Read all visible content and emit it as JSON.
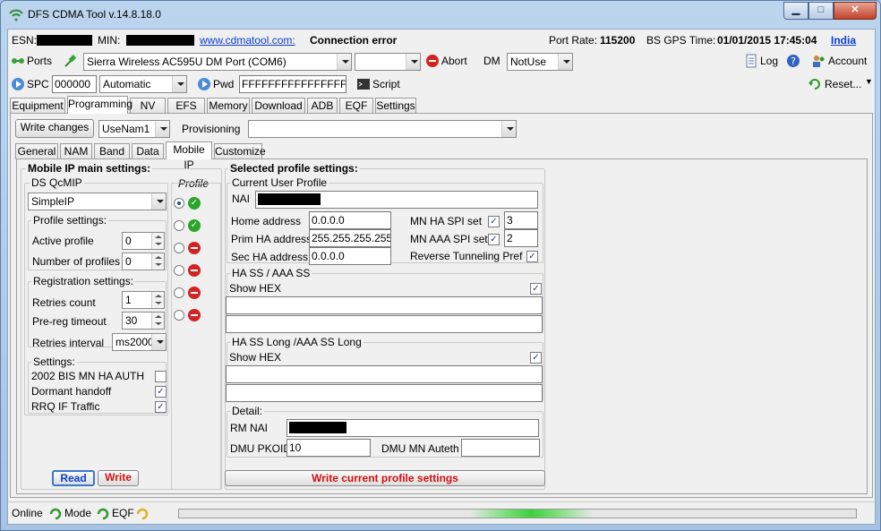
{
  "window": {
    "title": "DFS CDMA Tool v.14.8.18.0"
  },
  "infobar": {
    "esn_label": "ESN:",
    "min_label": "MIN:",
    "website": "www.cdmatool.com:",
    "connection_status": "Connection error",
    "port_rate_label": "Port Rate:",
    "port_rate_value": "115200",
    "bs_gps_label": "BS GPS Time:",
    "bs_gps_value": "01/01/2015 17:45:04",
    "region": "India"
  },
  "toolbar1": {
    "ports_label": "Ports",
    "port_select": "Sierra Wireless AC595U DM Port (COM6)",
    "second_select": "",
    "abort_label": "Abort",
    "dm_label": "DM",
    "dm_select": "NotUse",
    "log_label": "Log",
    "account_label": "Account"
  },
  "toolbar2": {
    "spc_label": "SPC",
    "spc_value": "000000",
    "spc_mode": "Automatic",
    "pwd_label": "Pwd",
    "pwd_value": "FFFFFFFFFFFFFFFF",
    "script_label": "Script",
    "reset_label": "Reset..."
  },
  "main_tabs": [
    "Equipment",
    "Programming",
    "NV",
    "EFS",
    "Memory",
    "Download",
    "ADB",
    "EQF",
    "Settings"
  ],
  "prog_bar": {
    "write_changes": "Write changes",
    "usename_select": "UseNam1",
    "provisioning_label": "Provisioning",
    "provisioning_select": ""
  },
  "sub_tabs": [
    "General",
    "NAM",
    "Band",
    "Data",
    "Mobile IP",
    "Customize"
  ],
  "left": {
    "group_title": "Mobile IP main settings:",
    "ds_qcmip_label": "DS QcMIP",
    "ds_qcmip_value": "SimpleIP",
    "profile_col": "Profile",
    "profile_settings_label": "Profile settings:",
    "active_profile_label": "Active profile",
    "active_profile_value": "0",
    "num_profiles_label": "Number of profiles",
    "num_profiles_value": "0",
    "registration_label": "Registration settings:",
    "retries_count_label": "Retries count",
    "retries_count_value": "1",
    "prereg_label": "Pre-reg timeout",
    "prereg_value": "30",
    "retries_interval_label": "Retries interval",
    "retries_interval_value": "ms2000",
    "settings_label": "Settings:",
    "bis_label": "2002 BIS MN HA AUTH",
    "dormant_label": "Dormant handoff",
    "rrq_label": "RRQ IF Traffic",
    "read_label": "Read",
    "write_label": "Write"
  },
  "right": {
    "group_title": "Selected profile settings:",
    "current_user_label": "Current User Profile",
    "nai_label": "NAI",
    "home_address_label": "Home address",
    "home_address_value": "0.0.0.0",
    "prim_ha_label": "Prim HA address",
    "prim_ha_value": "255.255.255.255",
    "sec_ha_label": "Sec HA address",
    "sec_ha_value": "0.0.0.0",
    "mn_ha_spi_label": "MN HA SPI set",
    "mn_ha_spi_value": "3",
    "mn_aaa_spi_label": "MN AAA SPI set",
    "mn_aaa_spi_value": "2",
    "reverse_tunnel_label": "Reverse Tunneling Pref",
    "ha_ss_label": "HA SS / AAA SS",
    "show_hex_1": "Show HEX",
    "ha_ss_long_label": "HA SS Long /AAA SS Long",
    "show_hex_2": "Show HEX",
    "detail_label": "Detail:",
    "rm_nai_label": "RM NAI",
    "dmu_pkoid_label": "DMU PKOID",
    "dmu_pkoid_value": "10",
    "dmu_mn_label": "DMU MN Auteth",
    "write_profile_label": "Write current profile settings"
  },
  "statusbar": {
    "online": "Online",
    "mode": "Mode",
    "eqf": "EQF"
  },
  "colors": {
    "link": "#0a3ec9",
    "write_red": "#d01010",
    "ok_green": "#2aa52a",
    "stop_red": "#d32222"
  }
}
